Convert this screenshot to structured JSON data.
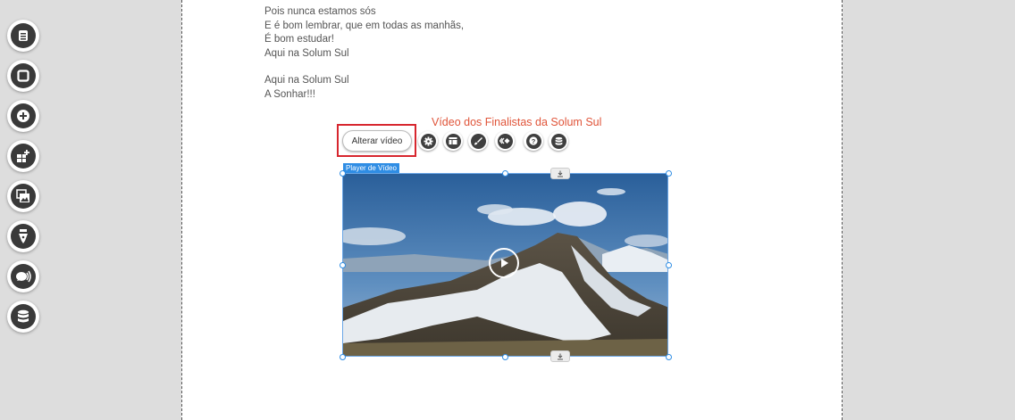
{
  "sidebar": {
    "tools": [
      {
        "icon": "document-icon"
      },
      {
        "icon": "square-icon"
      },
      {
        "icon": "plus-circle-icon"
      },
      {
        "icon": "add-widget-icon"
      },
      {
        "icon": "gallery-icon"
      },
      {
        "icon": "pen-nib-icon"
      },
      {
        "icon": "chat-audio-icon"
      },
      {
        "icon": "database-icon"
      }
    ]
  },
  "lyrics": {
    "lines_block1": [
      "Pois nunca estamos sós",
      "E é bom lembrar, que em todas as manhãs,",
      "É bom estudar!",
      "Aqui na Solum Sul"
    ],
    "lines_block2": [
      "Aqui na Solum Sul",
      "A Sonhar!!!"
    ]
  },
  "video": {
    "title": "Vídeo dos Finalistas da Solum Sul",
    "change_button_label": "Alterar vídeo",
    "player_label": "Player de Vídeo",
    "toolbar_icons": [
      "gear-icon",
      "layout-icon",
      "brush-icon",
      "code-icon",
      "help-icon",
      "database-icon"
    ]
  },
  "colors": {
    "accent_title": "#e0553a",
    "highlight_outline": "#d7262e",
    "selection_blue": "#2f8de4"
  }
}
